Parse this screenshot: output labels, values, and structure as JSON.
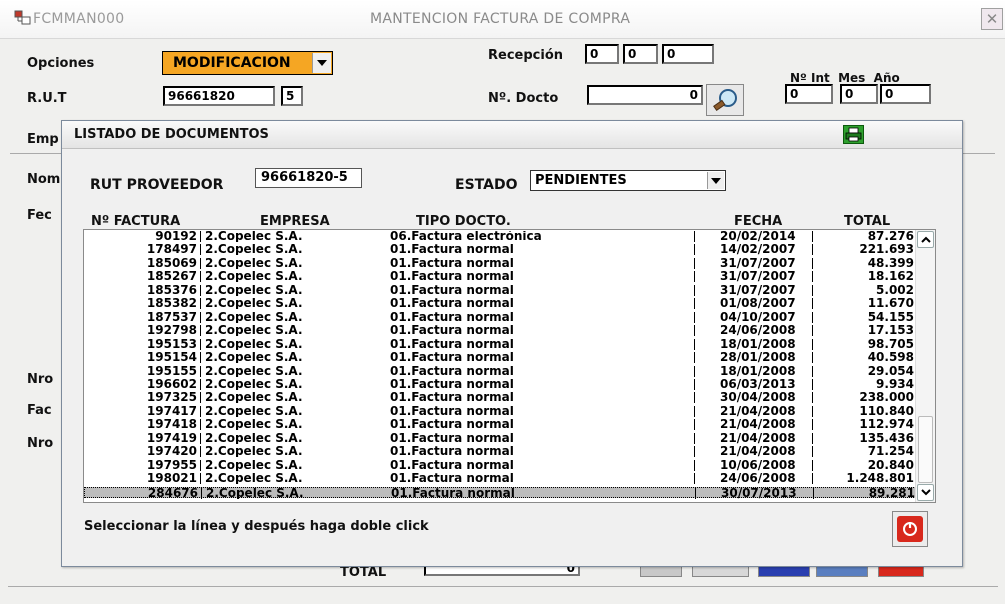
{
  "window": {
    "app_code": "FCMMAN000",
    "title": "MANTENCION FACTURA DE COMPRA",
    "close_glyph": "✕"
  },
  "main": {
    "opciones_label": "Opciones",
    "opciones_value": "MODIFICACION",
    "rut_label": "R.U.T",
    "rut_value": "96661820",
    "rut_dv": "5",
    "recepcion_label": "Recepción",
    "recepcion_values": [
      "0",
      "0",
      "0"
    ],
    "ndocto_label": "Nº. Docto",
    "ndocto_value": "0",
    "nint_header": "Nº Int  Mes  Año",
    "nint_values": [
      "0",
      "0",
      "0"
    ],
    "side_labels": {
      "emp": "Emp",
      "nom": "Nom",
      "fec": "Fec",
      "nro1": "Nro",
      "fac": "Fac",
      "nro2": "Nro"
    },
    "total_label": "TOTAL",
    "total_value": "0"
  },
  "dialog": {
    "title": "LISTADO DE DOCUMENTOS",
    "rut_proveedor_label": "RUT PROVEEDOR",
    "rut_proveedor_value": "96661820-5",
    "estado_label": "ESTADO",
    "estado_value": "PENDIENTES",
    "columns": {
      "factura": "Nº FACTURA",
      "empresa": "EMPRESA",
      "tipo": "TIPO DOCTO.",
      "fecha": "FECHA",
      "total": "TOTAL"
    },
    "rows": [
      [
        "90192",
        "2.Copelec S.A.",
        "06.Factura electrónica",
        "20/02/2014",
        "87.276"
      ],
      [
        "178497",
        "2.Copelec S.A.",
        "01.Factura normal",
        "14/02/2007",
        "221.693"
      ],
      [
        "185069",
        "2.Copelec S.A.",
        "01.Factura normal",
        "31/07/2007",
        "48.399"
      ],
      [
        "185267",
        "2.Copelec S.A.",
        "01.Factura normal",
        "31/07/2007",
        "18.162"
      ],
      [
        "185376",
        "2.Copelec S.A.",
        "01.Factura normal",
        "31/07/2007",
        "5.002"
      ],
      [
        "185382",
        "2.Copelec S.A.",
        "01.Factura normal",
        "01/08/2007",
        "11.670"
      ],
      [
        "187537",
        "2.Copelec S.A.",
        "01.Factura normal",
        "04/10/2007",
        "54.155"
      ],
      [
        "192798",
        "2.Copelec S.A.",
        "01.Factura normal",
        "24/06/2008",
        "17.153"
      ],
      [
        "195153",
        "2.Copelec S.A.",
        "01.Factura normal",
        "18/01/2008",
        "98.705"
      ],
      [
        "195154",
        "2.Copelec S.A.",
        "01.Factura normal",
        "28/01/2008",
        "40.598"
      ],
      [
        "195155",
        "2.Copelec S.A.",
        "01.Factura normal",
        "18/01/2008",
        "29.054"
      ],
      [
        "196602",
        "2.Copelec S.A.",
        "01.Factura normal",
        "06/03/2013",
        "9.934"
      ],
      [
        "197325",
        "2.Copelec S.A.",
        "01.Factura normal",
        "30/04/2008",
        "238.000"
      ],
      [
        "197417",
        "2.Copelec S.A.",
        "01.Factura normal",
        "21/04/2008",
        "110.840"
      ],
      [
        "197418",
        "2.Copelec S.A.",
        "01.Factura normal",
        "21/04/2008",
        "112.974"
      ],
      [
        "197419",
        "2.Copelec S.A.",
        "01.Factura normal",
        "21/04/2008",
        "135.436"
      ],
      [
        "197420",
        "2.Copelec S.A.",
        "01.Factura normal",
        "21/04/2008",
        "71.254"
      ],
      [
        "197955",
        "2.Copelec S.A.",
        "01.Factura normal",
        "10/06/2008",
        "20.840"
      ],
      [
        "198021",
        "2.Copelec S.A.",
        "01.Factura normal",
        "24/06/2008",
        "1.248.801"
      ],
      [
        "284676",
        "2.Copelec S.A.",
        "01.Factura normal",
        "30/07/2013",
        "89.281"
      ]
    ],
    "selected_row": 19,
    "hint": "Seleccionar la línea y después haga doble click"
  },
  "colors": {
    "opciones_bg": "#f5a623",
    "printer_icon": "#2ea02e",
    "exit_button": "#d8281c"
  },
  "icons": [
    "app-icon",
    "search-icon",
    "printer-icon",
    "power-icon",
    "chevron-down-icon",
    "chevron-up-icon"
  ]
}
